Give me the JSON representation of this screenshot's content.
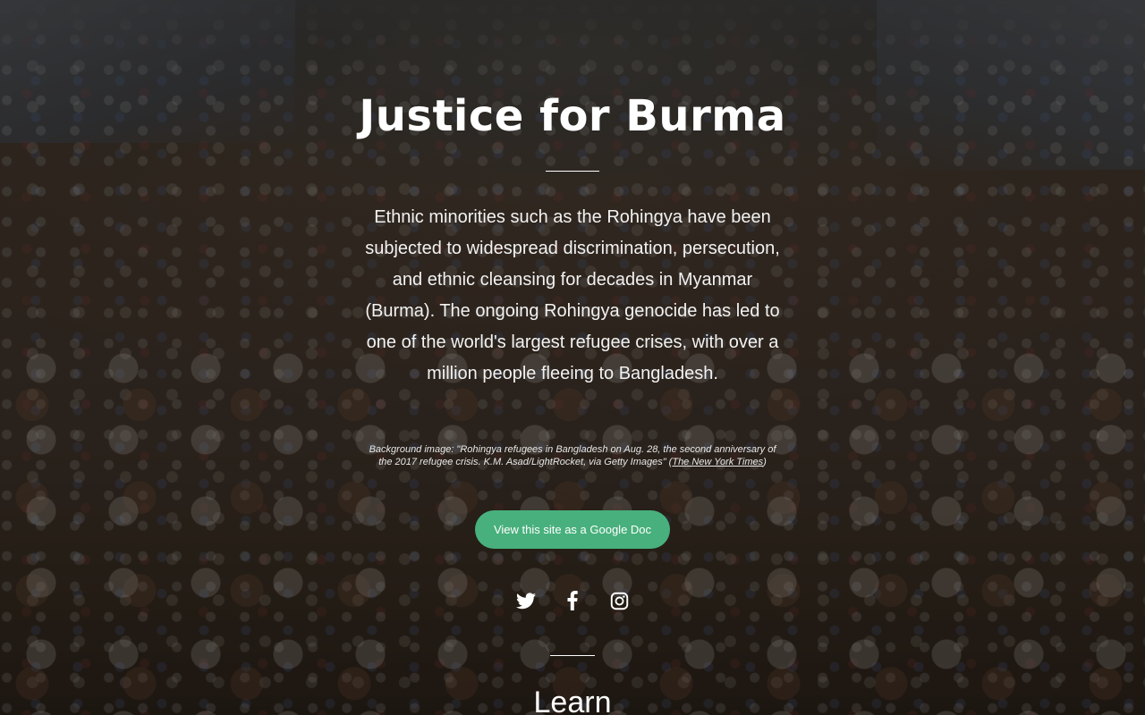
{
  "hero": {
    "title": "Justice for Burma",
    "intro": "Ethnic minorities such as the Rohingya have been subjected to widespread discrimination, persecution, and ethnic cleansing for decades in Myanmar (Burma). The ongoing Rohingya genocide has led to one of the world's largest refugee crises, with over a million people fleeing to Bangladesh.",
    "caption_text": "Background image: \"Rohingya refugees in Bangladesh on Aug. 28, the second anniversary of the 2017 refugee crisis. K.M. Asad/LightRocket, via Getty Images\" (",
    "caption_link": "The New York Times",
    "caption_end": ")",
    "button_label": "View this site as a Google Doc"
  },
  "social": [
    {
      "icon": "twitter-icon"
    },
    {
      "icon": "facebook-icon"
    },
    {
      "icon": "instagram-icon"
    }
  ],
  "next_section": {
    "title": "Learn"
  },
  "colors": {
    "button": "#48b07c",
    "text": "#ffffff"
  }
}
